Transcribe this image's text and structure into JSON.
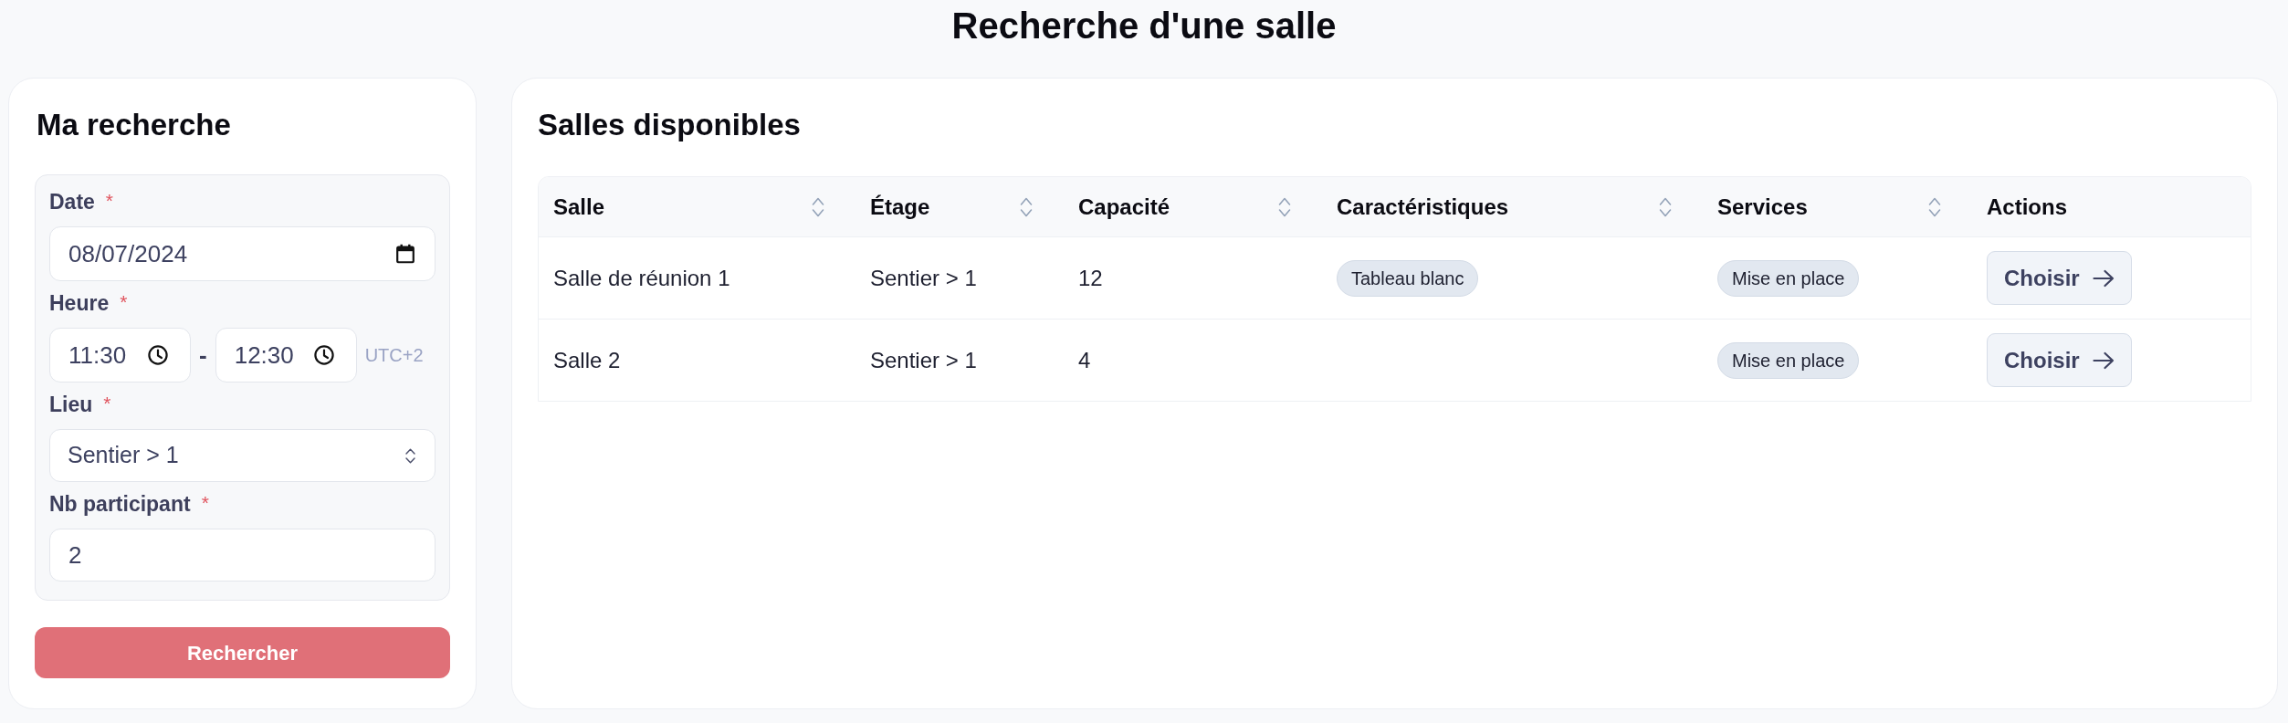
{
  "page": {
    "title": "Recherche d'une salle"
  },
  "search_panel": {
    "title": "Ma recherche",
    "fields": [
      {
        "kind": "date",
        "label": "Date",
        "required_mark": "*",
        "value": "08/07/2024"
      },
      {
        "kind": "time_range",
        "label": "Heure",
        "required_mark": "*",
        "start": "11:30",
        "separator": "-",
        "end": "12:30",
        "timezone": "UTC+2"
      },
      {
        "kind": "select",
        "label": "Lieu",
        "required_mark": "*",
        "value": "Sentier > 1"
      },
      {
        "kind": "number",
        "label": "Nb participant",
        "required_mark": "*",
        "value": "2"
      }
    ],
    "submit_button": "Rechercher"
  },
  "results_panel": {
    "title": "Salles disponibles",
    "table": {
      "columns": [
        {
          "label": "Salle",
          "sortable": true
        },
        {
          "label": "Étage",
          "sortable": true
        },
        {
          "label": "Capacité",
          "sortable": true
        },
        {
          "label": "Caractéristiques",
          "sortable": true
        },
        {
          "label": "Services",
          "sortable": true
        },
        {
          "label": "Actions",
          "sortable": false
        }
      ],
      "rows": [
        {
          "salle": "Salle de réunion 1",
          "etage": "Sentier > 1",
          "capacite": "12",
          "caracteristiques": [
            "Tableau blanc"
          ],
          "services": [
            "Mise en place"
          ],
          "action": "Choisir"
        },
        {
          "salle": "Salle 2",
          "etage": "Sentier > 1",
          "capacite": "4",
          "services": [
            "Mise en place"
          ],
          "action": "Choisir"
        }
      ]
    }
  }
}
